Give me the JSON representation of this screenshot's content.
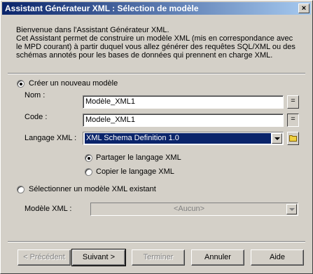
{
  "window": {
    "title": "Assistant Générateur XML : Sélection de modèle",
    "close_glyph": "×"
  },
  "intro": {
    "line1": "Bienvenue dans l'Assistant Générateur XML.",
    "line2": "Cet Assistant permet de construire un modèle XML (mis en correspondance avec le MPD courant) à partir duquel vous allez générer des requêtes SQL/XML ou des schémas annotés pour les bases de données qui prennent en charge XML."
  },
  "new_model": {
    "radio_label": "Créer un nouveau modèle",
    "checked": true,
    "name_label": "Nom :",
    "name_value": "Modèle_XML1",
    "code_label": "Code :",
    "code_value": "Modele_XML1",
    "equals_glyph": "=",
    "language_label": "Langage XML :",
    "language_value": "XML Schema Definition 1.0",
    "share_label": "Partager le langage XML",
    "share_checked": true,
    "copy_label": "Copier le langage XML",
    "copy_checked": false
  },
  "existing_model": {
    "radio_label": "Sélectionner un modèle XML existant",
    "checked": false,
    "model_label": "Modèle XML :",
    "model_value": "<Aucun>"
  },
  "buttons": {
    "previous": "< Précédent",
    "next": "Suivant >",
    "finish": "Terminer",
    "cancel": "Annuler",
    "help": "Aide"
  },
  "colors": {
    "titlebar_start": "#0a246a",
    "titlebar_end": "#a6caf0",
    "selection": "#0a246a",
    "face": "#d4d0c8",
    "folder": "#f0d040"
  },
  "icons": {
    "folder": "folder-icon",
    "dropdown": "chevron-down-icon",
    "close": "close-icon"
  }
}
